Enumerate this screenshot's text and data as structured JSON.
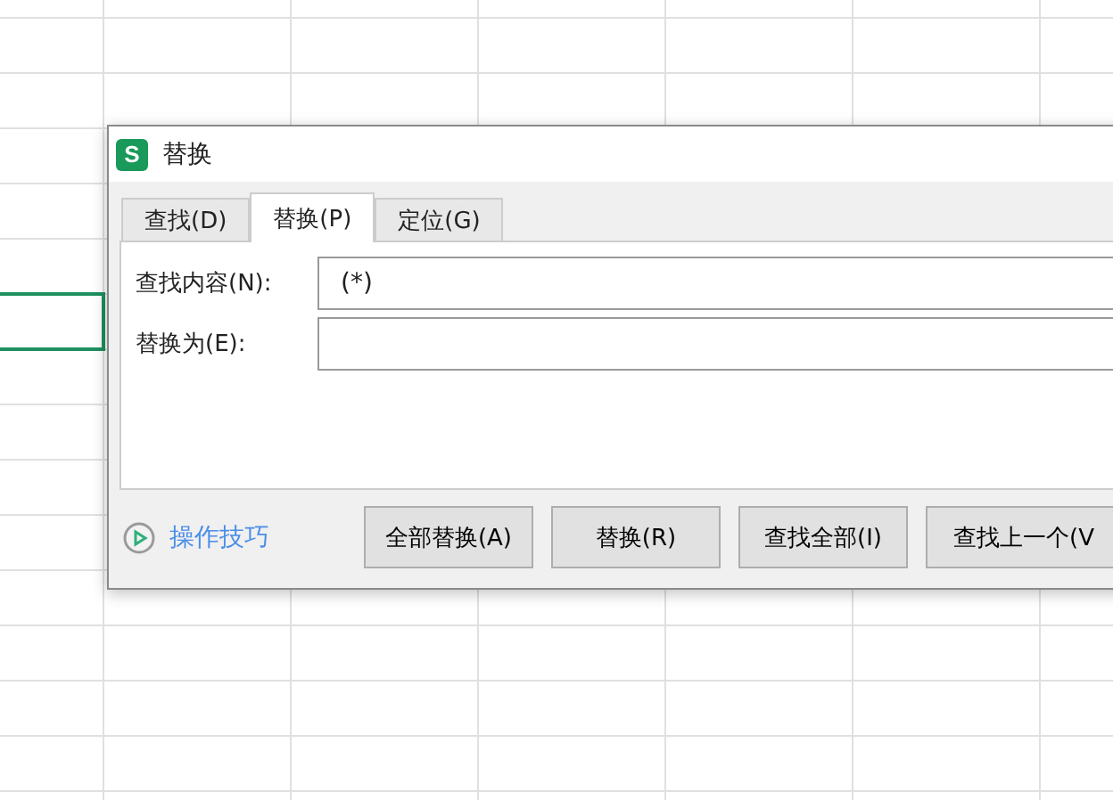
{
  "window": {
    "logo": "S",
    "title": "替换"
  },
  "tabs": [
    {
      "label": "查找(D)",
      "selected": false
    },
    {
      "label": "替换(P)",
      "selected": true
    },
    {
      "label": "定位(G)",
      "selected": false
    }
  ],
  "fields": [
    {
      "label": "查找内容(N):",
      "value": "(*)"
    },
    {
      "label": "替换为(E):"
    }
  ],
  "tips_link": "操作技巧",
  "buttons": [
    "全部替换(A)",
    "替换(R)",
    "查找全部(I)",
    "查找上一个(V"
  ]
}
